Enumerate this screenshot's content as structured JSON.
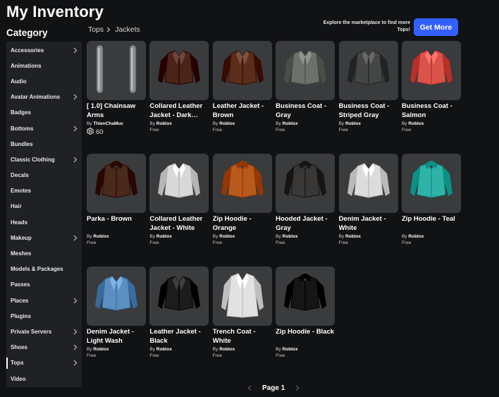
{
  "header": {
    "title": "My Inventory",
    "category_heading": "Category",
    "breadcrumb": [
      "Tops",
      "Jackets"
    ],
    "promo_text": "Explore the marketplace to find more Tops!",
    "get_more_label": "Get More"
  },
  "sidebar": {
    "items": [
      {
        "label": "Accessories",
        "chevron": true
      },
      {
        "label": "Animations",
        "chevron": false
      },
      {
        "label": "Audio",
        "chevron": false
      },
      {
        "label": "Avatar Animations",
        "chevron": true
      },
      {
        "label": "Badges",
        "chevron": false
      },
      {
        "label": "Bottoms",
        "chevron": true
      },
      {
        "label": "Bundles",
        "chevron": false
      },
      {
        "label": "Classic Clothing",
        "chevron": true
      },
      {
        "label": "Decals",
        "chevron": false
      },
      {
        "label": "Emotes",
        "chevron": false
      },
      {
        "label": "Hair",
        "chevron": false
      },
      {
        "label": "Heads",
        "chevron": false
      },
      {
        "label": "Makeup",
        "chevron": true
      },
      {
        "label": "Meshes",
        "chevron": false
      },
      {
        "label": "Models & Packages",
        "chevron": false
      },
      {
        "label": "Passes",
        "chevron": false
      },
      {
        "label": "Places",
        "chevron": true
      },
      {
        "label": "Plugins",
        "chevron": false
      },
      {
        "label": "Private Servers",
        "chevron": true
      },
      {
        "label": "Shoes",
        "chevron": true
      },
      {
        "label": "Tops",
        "chevron": true,
        "selected": true
      },
      {
        "label": "Video",
        "chevron": false
      }
    ]
  },
  "items": [
    {
      "name": "[ 1.0] Chainsaw Arms",
      "by": "By",
      "creator": "ThienChaMuc",
      "price": "60",
      "robux": true,
      "icon": "chainsaw-arms",
      "color": "#8a8c8e"
    },
    {
      "name": "Collared Leather Jacket - Dark Brown",
      "by": "By",
      "creator": "Roblox",
      "price": "Free",
      "icon": "jacket",
      "color": "#4a2418"
    },
    {
      "name": "Leather Jacket - Brown",
      "by": "By",
      "creator": "Roblox",
      "price": "Free",
      "icon": "jacket",
      "color": "#5a2e1a"
    },
    {
      "name": "Business Coat - Gray",
      "by": "By",
      "creator": "Roblox",
      "price": "Free",
      "icon": "coat",
      "color": "#6d716a"
    },
    {
      "name": "Business Coat - Striped Gray",
      "by": "By",
      "creator": "Roblox",
      "price": "Free",
      "icon": "coat",
      "color": "#444546"
    },
    {
      "name": "Business Coat - Salmon",
      "by": "By",
      "creator": "Roblox",
      "price": "Free",
      "icon": "coat",
      "color": "#d9534a"
    },
    {
      "name": "Parka - Brown",
      "by": "By",
      "creator": "Roblox",
      "price": "Free",
      "icon": "parka",
      "color": "#4a2a1c"
    },
    {
      "name": "Collared Leather Jacket - White",
      "by": "By",
      "creator": "Roblox",
      "price": "Free",
      "icon": "jacket",
      "color": "#d8d8d8"
    },
    {
      "name": "Zip Hoodie - Orange",
      "by": "By",
      "creator": "Roblox",
      "price": "Free",
      "icon": "hoodie",
      "color": "#b85a1e"
    },
    {
      "name": "Hooded Jacket - Gray",
      "by": "By",
      "creator": "Roblox",
      "price": "Free",
      "icon": "hoodie",
      "color": "#3a3836"
    },
    {
      "name": "Denim Jacket - White",
      "by": "By",
      "creator": "Roblox",
      "price": "Free",
      "icon": "jacket",
      "color": "#dcdcdc"
    },
    {
      "name": "Zip Hoodie - Teal",
      "by": "By",
      "creator": "Roblox",
      "price": "Free",
      "icon": "hoodie",
      "color": "#2fb3a8"
    },
    {
      "name": "Denim Jacket - Light Wash",
      "by": "By",
      "creator": "Roblox",
      "price": "Free",
      "icon": "jacket",
      "color": "#5b8fc2"
    },
    {
      "name": "Leather Jacket - Black",
      "by": "By",
      "creator": "Roblox",
      "price": "Free",
      "icon": "jacket",
      "color": "#1c1c1e"
    },
    {
      "name": "Trench Coat - White",
      "by": "By",
      "creator": "Roblox",
      "price": "Free",
      "icon": "trench",
      "color": "#e2e2e2"
    },
    {
      "name": "Zip Hoodie - Black",
      "by": "By",
      "creator": "Roblox",
      "price": "Free",
      "icon": "hoodie",
      "color": "#161616"
    }
  ],
  "pager": {
    "label": "Page 1"
  },
  "colors": {
    "accent": "#335fff",
    "background": "#111214",
    "sidebar": "#1f2124",
    "thumb": "#393b3d"
  }
}
